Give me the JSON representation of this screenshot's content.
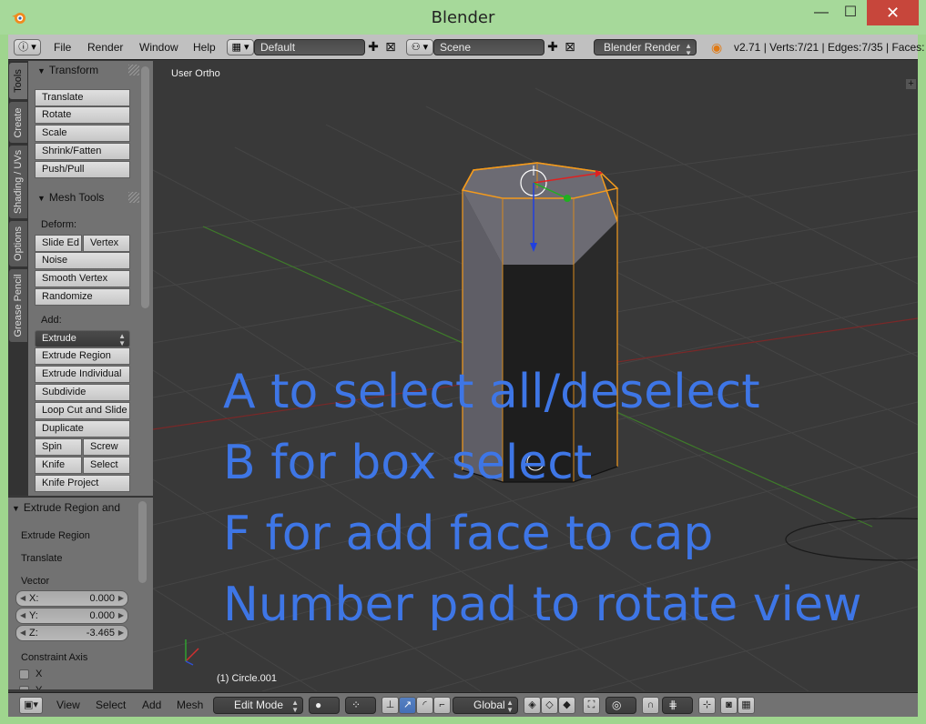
{
  "window": {
    "title": "Blender",
    "minimize": "—",
    "maximize": "☐",
    "close": "✕"
  },
  "info_header": {
    "menus": [
      "File",
      "Render",
      "Window",
      "Help"
    ],
    "screen_layout": "Default",
    "scene": "Scene",
    "render_engine": "Blender Render",
    "stats": "v2.71 | Verts:7/21 | Edges:7/35 | Faces:"
  },
  "tabs": [
    "Tools",
    "Create",
    "Shading / UVs",
    "Options",
    "Grease Pencil"
  ],
  "toolshelf": {
    "transform_header": "Transform",
    "transform": [
      "Translate",
      "Rotate",
      "Scale",
      "Shrink/Fatten",
      "Push/Pull"
    ],
    "mesh_tools_header": "Mesh Tools",
    "deform_label": "Deform:",
    "slide_edge": "Slide Ed",
    "vertex": "Vertex",
    "noise": "Noise",
    "smooth_vertex": "Smooth Vertex",
    "randomize": "Randomize",
    "add_label": "Add:",
    "extrude": "Extrude",
    "extrude_region": "Extrude Region",
    "extrude_individual": "Extrude Individual",
    "subdivide": "Subdivide",
    "loop_cut": "Loop Cut and Slide",
    "duplicate": "Duplicate",
    "spin": "Spin",
    "screw": "Screw",
    "knife": "Knife",
    "select": "Select",
    "knife_project": "Knife Project"
  },
  "operator_panel": {
    "header": "Extrude Region and",
    "op_name": "Extrude Region",
    "translate": "Translate",
    "vector_label": "Vector",
    "x_label": "X:",
    "x_value": "0.000",
    "y_label": "Y:",
    "y_value": "0.000",
    "z_label": "Z:",
    "z_value": "-3.465",
    "constraint_label": "Constraint Axis",
    "constraint_x": "X",
    "constraint_y": "Y"
  },
  "viewport": {
    "view_name": "User Ortho",
    "object_info": "(1) Circle.001",
    "overlay_lines": [
      "A to select all/deselect",
      "B for box select",
      "F for add face to cap",
      "Number pad to rotate view"
    ],
    "overlay_color": "#3e76e6",
    "selection_color": "#f39a1d",
    "x_axis_color": "#8a2a2a",
    "y_axis_color": "#3f8a2a"
  },
  "bottom_header": {
    "menus": [
      "View",
      "Select",
      "Add",
      "Mesh"
    ],
    "mode": "Edit Mode",
    "orientation": "Global"
  }
}
